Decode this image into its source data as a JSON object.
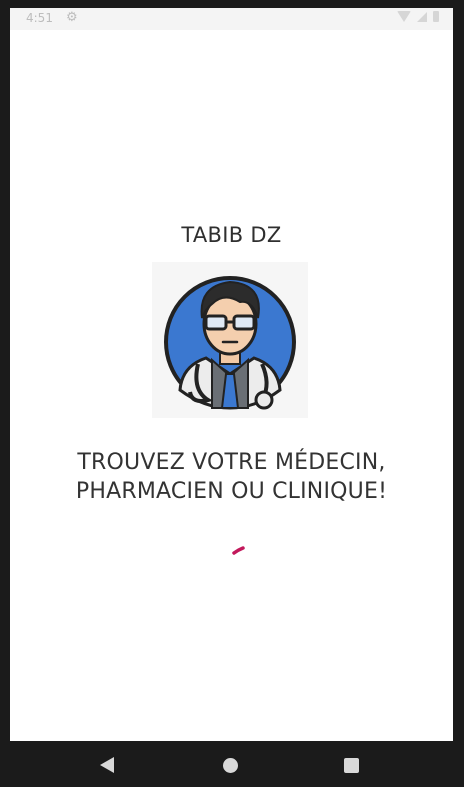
{
  "statusbar": {
    "time": "4:51",
    "settings_icon": "gear-icon",
    "wifi_icon": "wifi-icon",
    "signal_icon": "signal-icon",
    "battery_icon": "battery-icon"
  },
  "app": {
    "title": "TABIB DZ",
    "avatar_icon": "doctor-avatar-icon",
    "tagline_line1": "TROUVEZ VOTRE MÉDECIN,",
    "tagline_line2": "PHARMACIEN OU CLINIQUE!",
    "spinner_color": "#c2185b"
  },
  "navbar": {
    "back_icon": "back-triangle-icon",
    "home_icon": "home-circle-icon",
    "recents_icon": "recents-square-icon"
  },
  "colors": {
    "avatar_bg": "#3b78d0",
    "text": "#333333",
    "accent": "#c2185b"
  }
}
